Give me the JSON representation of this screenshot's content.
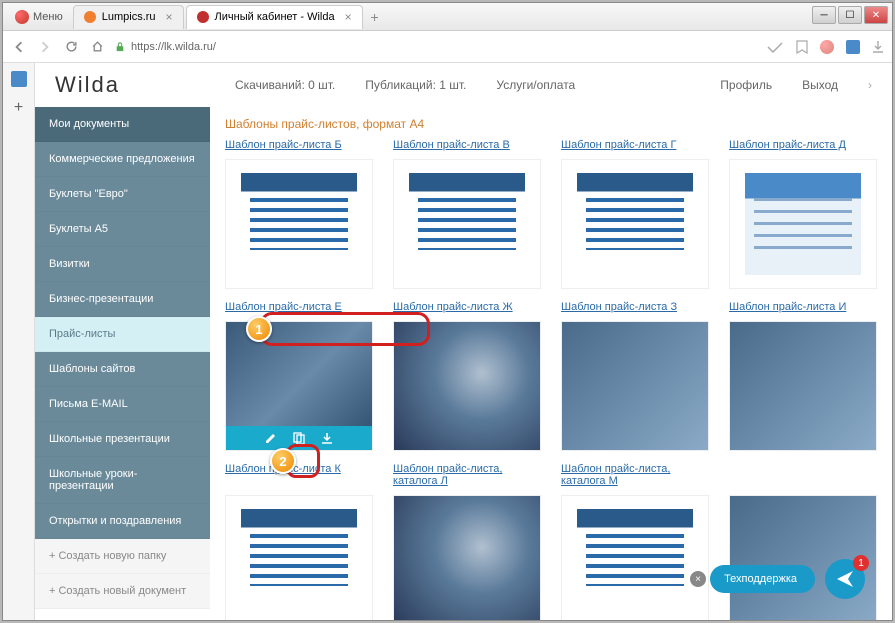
{
  "window": {
    "menu_label": "Меню",
    "tabs": [
      {
        "label": "Lumpics.ru",
        "icon_color": "#f08030"
      },
      {
        "label": "Личный кабинет - Wilda",
        "icon_color": "#c03030"
      }
    ],
    "url": "https://lk.wilda.ru/"
  },
  "header": {
    "logo": "Wilda",
    "stats": [
      "Скачиваний: 0 шт.",
      "Публикаций: 1 шт."
    ],
    "services_link": "Услуги/оплата",
    "profile_link": "Профиль",
    "exit_link": "Выход"
  },
  "sidebar": {
    "items": [
      {
        "label": "Мои документы",
        "cls": "dark"
      },
      {
        "label": "Коммерческие предложения",
        "cls": "medium"
      },
      {
        "label": "Буклеты \"Евро\"",
        "cls": "medium"
      },
      {
        "label": "Буклеты А5",
        "cls": "medium"
      },
      {
        "label": "Визитки",
        "cls": "medium"
      },
      {
        "label": "Бизнес-презентации",
        "cls": "medium"
      },
      {
        "label": "Прайс-листы",
        "cls": "active"
      },
      {
        "label": "Шаблоны сайтов",
        "cls": "medium"
      },
      {
        "label": "Письма E-MAIL",
        "cls": "medium"
      },
      {
        "label": "Школьные презентации",
        "cls": "medium"
      },
      {
        "label": "Школьные уроки-презентации",
        "cls": "medium"
      },
      {
        "label": "Открытки и поздравления",
        "cls": "medium"
      },
      {
        "label": "+ Создать новую папку",
        "cls": "pale"
      },
      {
        "label": "+ Создать новый документ",
        "cls": "pale"
      }
    ]
  },
  "page_heading": "Шаблоны прайс-листов, формат А4",
  "templates": {
    "row1": [
      "Шаблон прайс-листа Б",
      "Шаблон прайс-листа В",
      "Шаблон прайс-листа Г",
      "Шаблон прайс-листа Д"
    ],
    "row2": [
      "Шаблон прайс-листа Е",
      "Шаблон прайс-листа Ж",
      "Шаблон прайс-листа З",
      "Шаблон прайс-листа И"
    ],
    "row3": [
      "Шаблон прайс-листа К",
      "Шаблон прайс-листа, каталога Л",
      "Шаблон прайс-листа, каталога М",
      ""
    ]
  },
  "support": {
    "label": "Техподдержка",
    "badge": "1"
  },
  "annotations": {
    "marker1": "1",
    "marker2": "2"
  }
}
